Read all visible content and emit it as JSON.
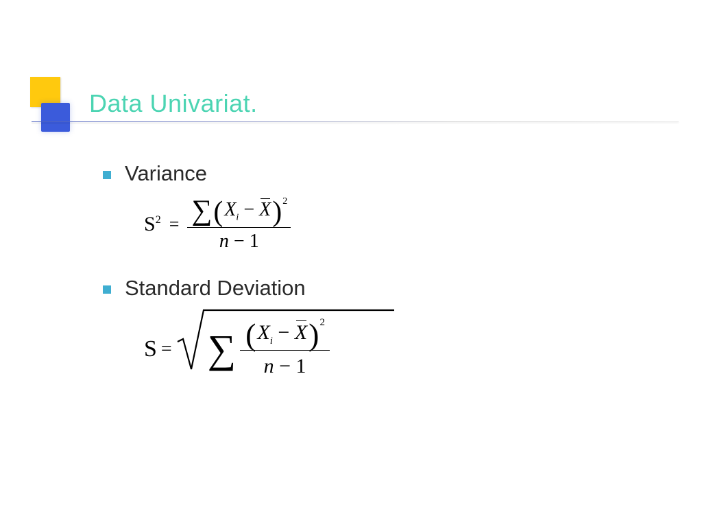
{
  "title": "Data Univariat.",
  "bullets": {
    "variance": {
      "label": "Variance"
    },
    "stddev": {
      "label": "Standard Deviation"
    }
  },
  "formula": {
    "variance": {
      "lhs_symbol": "S",
      "lhs_power": "2",
      "sum_var": "X",
      "sum_sub": "i",
      "mean_var": "X",
      "minus": "−",
      "sq_power": "2",
      "denom_n": "n",
      "denom_minus": "−",
      "denom_one": "1"
    },
    "stddev": {
      "lhs_symbol": "S",
      "sum_var": "X",
      "sum_sub": "i",
      "mean_var": "X",
      "minus": "−",
      "sq_power": "2",
      "denom_n": "n",
      "denom_minus": "−",
      "denom_one": "1"
    }
  }
}
